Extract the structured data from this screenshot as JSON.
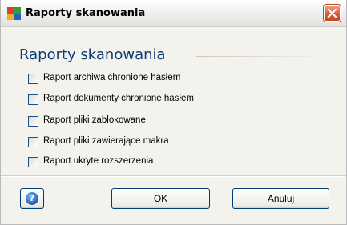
{
  "window": {
    "title": "Raporty skanowania"
  },
  "content": {
    "heading": "Raporty skanowania",
    "options": [
      {
        "label": "Raport archiwa chronione hasłem",
        "checked": false
      },
      {
        "label": "Raport dokumenty chronione hasłem",
        "checked": false
      },
      {
        "label": "Raport pliki zablokowane",
        "checked": false
      },
      {
        "label": "Raport pliki zawierające makra",
        "checked": false
      },
      {
        "label": "Raport ukryte rozszerzenia",
        "checked": false
      }
    ]
  },
  "buttons": {
    "help_glyph": "?",
    "ok_label": "OK",
    "cancel_label": "Anuluj"
  },
  "colors": {
    "heading": "#0d3a7a",
    "close_button": "#d55a36",
    "checkbox_border": "#1c5180"
  },
  "icons": {
    "app": "avg-app-icon",
    "close": "close-icon",
    "help": "help-icon"
  }
}
